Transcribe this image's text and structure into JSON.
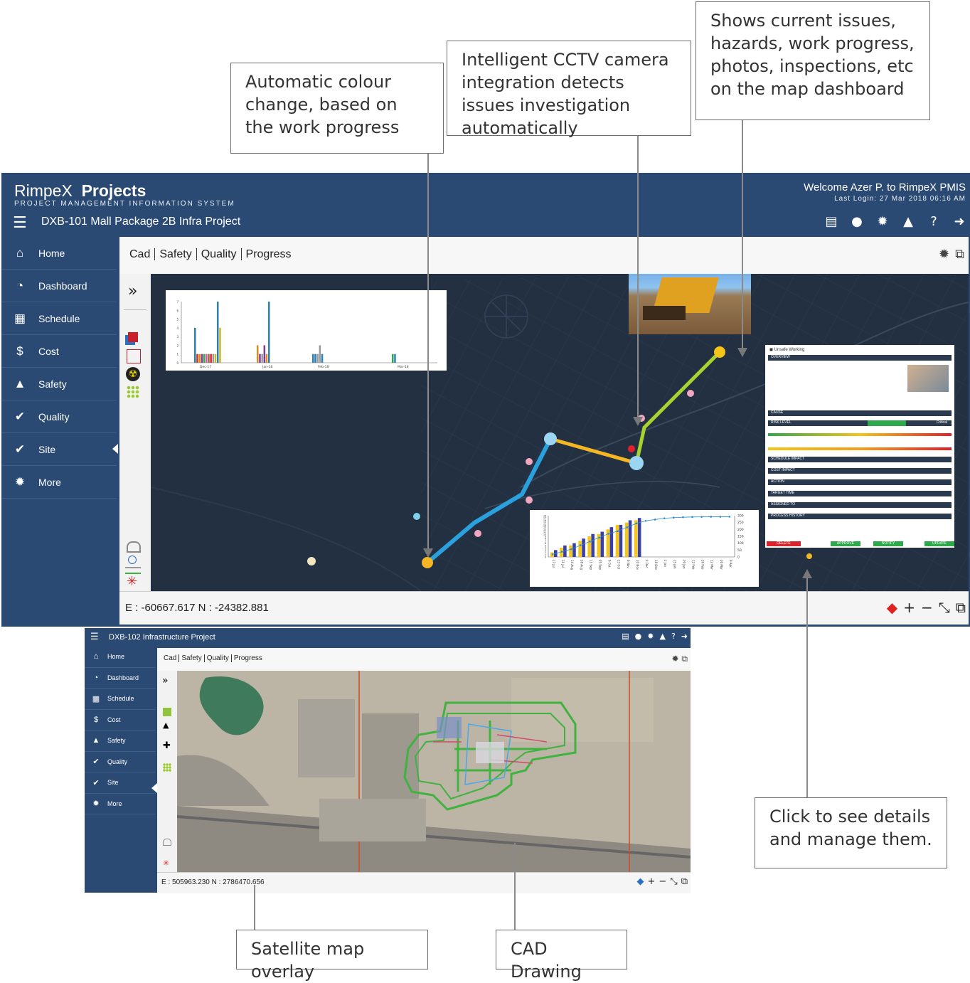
{
  "callouts": {
    "colour_change": "Automatic colour change, based on the work progress",
    "cctv": "Intelligent CCTV camera integration detects issues investigation automatically",
    "issues": "Shows current issues, hazards, work progress, photos, inspections, etc on the map dashboard",
    "click_details": "Click to see details and manage them.",
    "satellite": "Satellite map overlay",
    "cad": "CAD Drawing"
  },
  "app1": {
    "brand": "RimpeX",
    "brand_bold": "Projects",
    "brand_sub": "PROJECT MANAGEMENT INFORMATION SYSTEM",
    "welcome": "Welcome Azer P. to RimpeX PMIS",
    "last_login": "Last Login: 27 Mar 2018 06:16 AM",
    "project": "DXB-101  Mall Package 2B Infra Project",
    "sidebar": [
      {
        "icon": "home-icon",
        "glyph": "⌂",
        "label": "Home"
      },
      {
        "icon": "dashboard-icon",
        "glyph": "◔",
        "label": "Dashboard"
      },
      {
        "icon": "calendar-icon",
        "glyph": "▦",
        "label": "Schedule"
      },
      {
        "icon": "dollar-icon",
        "glyph": "$",
        "label": "Cost"
      },
      {
        "icon": "safety-cone-icon",
        "glyph": "▲",
        "label": "Safety"
      },
      {
        "icon": "quality-check-icon",
        "glyph": "✔",
        "label": "Quality"
      },
      {
        "icon": "site-check-icon",
        "glyph": "✔",
        "label": "Site"
      },
      {
        "icon": "gear-icon",
        "glyph": "✹",
        "label": "More"
      }
    ],
    "tabs": [
      "Cad",
      "Safety",
      "Quality",
      "Progress"
    ],
    "coords": "E : -60667.617 N : -24382.881"
  },
  "app2": {
    "project": "DXB-102  Infrastructure Project",
    "sidebar": [
      "Home",
      "Dashboard",
      "Schedule",
      "Cost",
      "Safety",
      "Quality",
      "Site",
      "More"
    ],
    "tabs": [
      "Cad",
      "Safety",
      "Quality",
      "Progress"
    ],
    "coords": "E : 505963.230 N : 2786470.656"
  },
  "bar_chart": {
    "categories": [
      "Dec-17",
      "Jan-18",
      "Feb-18",
      "Mar-18"
    ],
    "yticks": [
      "0",
      "1",
      "2",
      "3",
      "4",
      "5",
      "6",
      "7"
    ]
  },
  "combo_chart": {
    "right_ticks": [
      "300",
      "250",
      "200",
      "150",
      "100",
      "50",
      "0"
    ],
    "x_labels": [
      "17 Jul",
      "31 Jul",
      "14 Aug",
      "28 Aug",
      "11 Sep",
      "25 Sep",
      "9 Oct",
      "23 Oct",
      "6 Nov",
      "20 Nov",
      "4 Dec",
      "18 Dec",
      "1 Jan",
      "15 Jan",
      "29 Jan",
      "12 Feb",
      "26 Feb",
      "12 Mar",
      "26 Mar",
      "9 Apr"
    ],
    "bars_a": [
      2,
      4,
      5,
      7,
      9,
      10,
      12,
      14,
      15,
      16
    ],
    "bars_b": [
      3,
      5,
      6,
      8,
      10,
      11,
      13,
      14,
      16,
      17
    ],
    "line": [
      20,
      40,
      60,
      90,
      120,
      150,
      180,
      200,
      230,
      260,
      280,
      290,
      300,
      305,
      308,
      310,
      311,
      312,
      312,
      312
    ]
  },
  "issue_card": {
    "title": "Unsafe Working",
    "sections": [
      "OVERVIEW",
      "CAUSE",
      "RISK LEVEL",
      "SCHEDULE IMPACT",
      "COST IMPACT",
      "ACTION",
      "TARGET TIME",
      "ASSIGNED TO",
      "PROCESS HISTORY"
    ],
    "risk": "Critical",
    "buttons": [
      "DELETE",
      "APPROVE",
      "NOTIFY",
      "UPDATE"
    ]
  },
  "colors": {
    "header_bg": "#2b4a73",
    "route_blue": "#2aa0dd",
    "route_orange": "#f5b623",
    "route_green": "#a8d230"
  }
}
